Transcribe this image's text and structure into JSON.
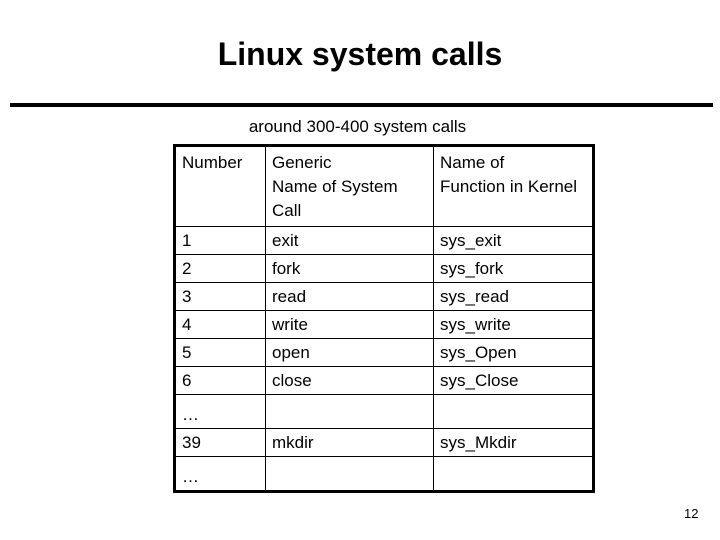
{
  "slide": {
    "title": "Linux system calls",
    "subtitle": "around 300-400 system calls",
    "page_number": "12"
  },
  "table": {
    "headers": [
      [
        "Number"
      ],
      [
        "Generic",
        "Name of System",
        "Call"
      ],
      [
        "Name of",
        "Function in Kernel"
      ]
    ],
    "rows": [
      {
        "number": "1",
        "generic": "exit",
        "kernel": "sys_exit"
      },
      {
        "number": "2",
        "generic": "fork",
        "kernel": "sys_fork"
      },
      {
        "number": "3",
        "generic": "read",
        "kernel": "sys_read"
      },
      {
        "number": "4",
        "generic": "write",
        "kernel": "sys_write"
      },
      {
        "number": "5",
        "generic": "open",
        "kernel": "sys_Open"
      },
      {
        "number": "6",
        "generic": "close",
        "kernel": "sys_Close"
      },
      {
        "number": "…",
        "generic": "",
        "kernel": ""
      },
      {
        "number": "39",
        "generic": "mkdir",
        "kernel": "sys_Mkdir"
      },
      {
        "number": "…",
        "generic": "",
        "kernel": ""
      }
    ]
  }
}
